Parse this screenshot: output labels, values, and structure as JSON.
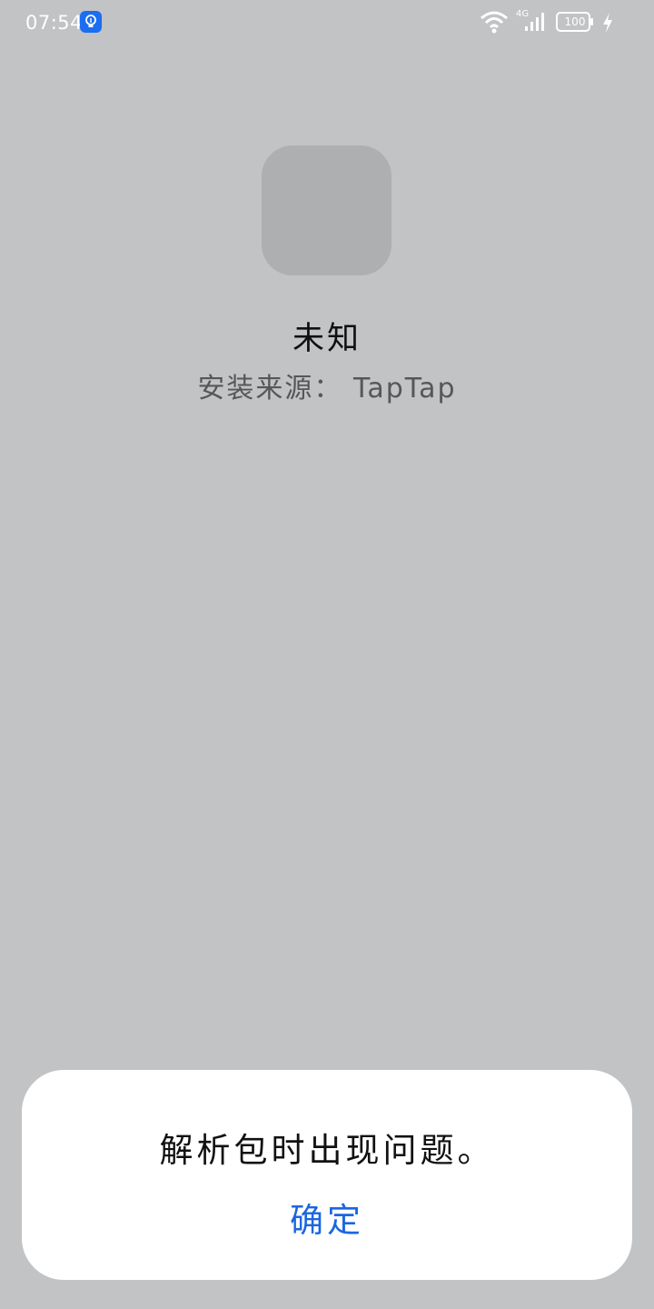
{
  "status_bar": {
    "time": "07:54",
    "network_type": "4G",
    "battery": "100"
  },
  "app": {
    "name": "未知",
    "install_source": "安装来源： TapTap"
  },
  "dialog": {
    "message": "解析包时出现问题。",
    "confirm_label": "确定"
  },
  "colors": {
    "background": "#c1c3c5",
    "accent": "#1b66e0",
    "icon_placeholder": "#aeafb1"
  }
}
